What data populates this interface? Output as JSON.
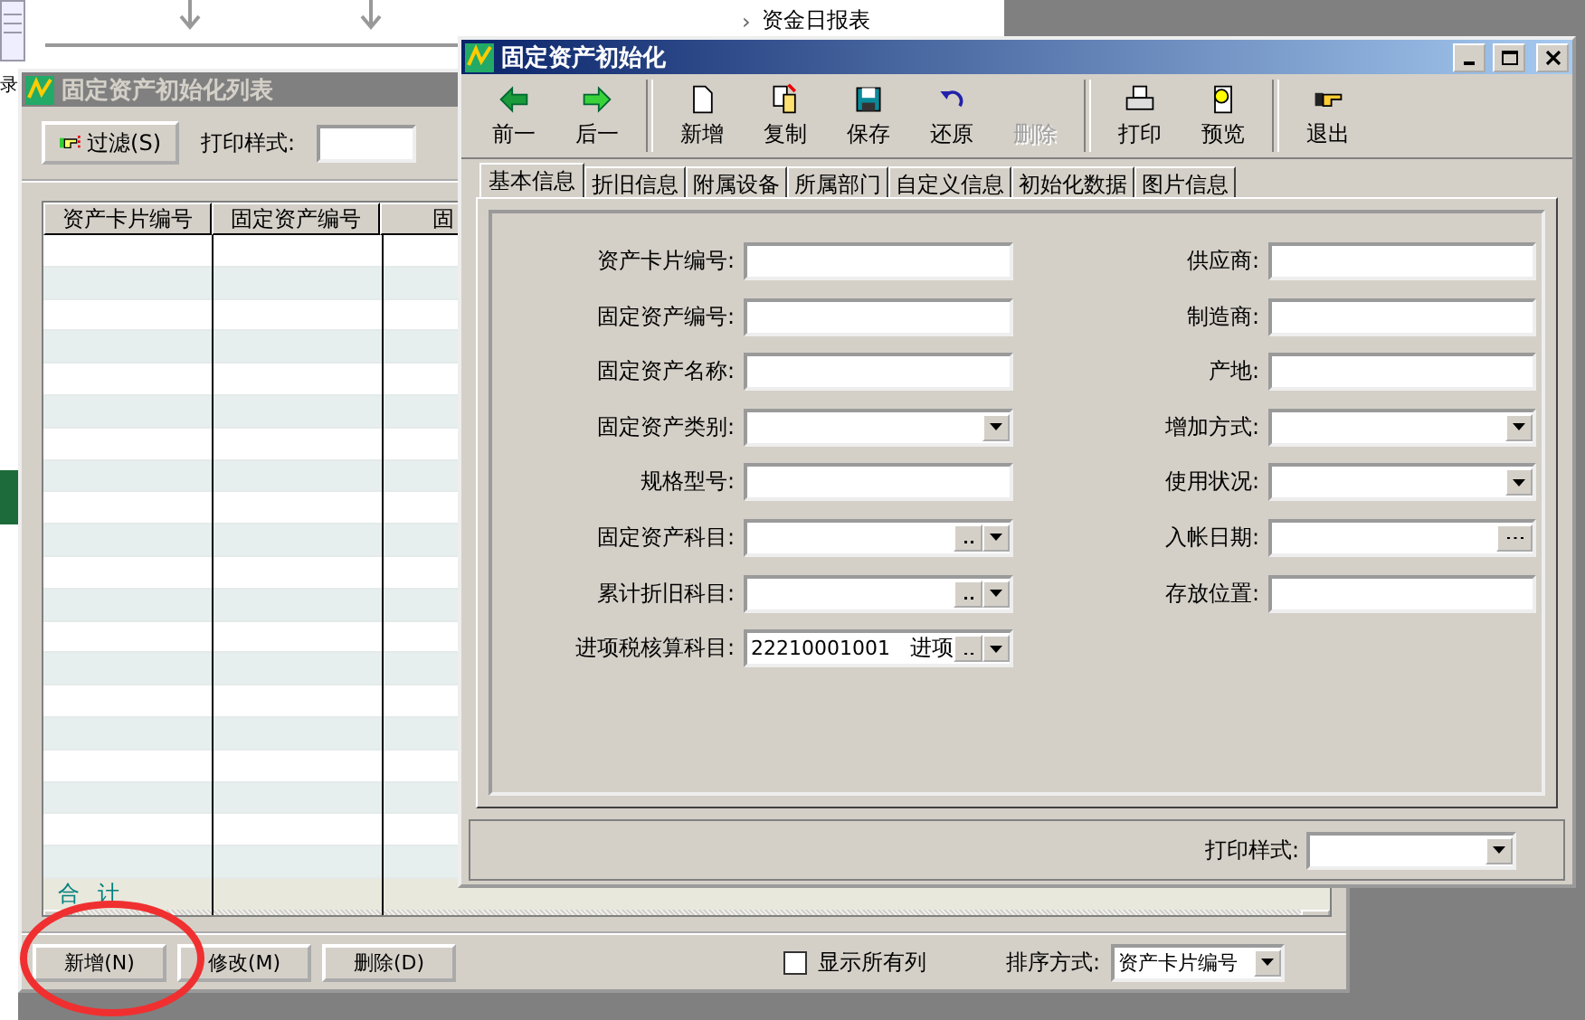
{
  "background": {
    "flow_caret": "›",
    "flow_label": "资金日报表",
    "left_label": "录"
  },
  "list_window": {
    "title": "固定资产初始化列表",
    "filter_button": "过滤(S)",
    "print_style_label": "打印样式:",
    "columns": [
      "资产卡片编号",
      "固定资产编号",
      "固"
    ],
    "total_label": "合 计",
    "buttons": [
      {
        "label": "新增(N)"
      },
      {
        "label": "修改(M)"
      },
      {
        "label": "删除(D)"
      }
    ],
    "show_all_columns": {
      "label": "显示所有列",
      "checked": false
    },
    "sort": {
      "label": "排序方式:",
      "value": "资产卡片编号"
    }
  },
  "dialog": {
    "title": "固定资产初始化",
    "toolbar": [
      [
        {
          "label": "前一",
          "kind": "prev",
          "disabled": false
        },
        {
          "label": "后一",
          "kind": "next",
          "disabled": false
        }
      ],
      [
        {
          "label": "新增",
          "kind": "new",
          "disabled": false
        },
        {
          "label": "复制",
          "kind": "copy",
          "disabled": false
        },
        {
          "label": "保存",
          "kind": "save",
          "disabled": false
        },
        {
          "label": "还原",
          "kind": "undo",
          "disabled": false
        },
        {
          "label": "删除",
          "kind": "delete",
          "disabled": true
        }
      ],
      [
        {
          "label": "打印",
          "kind": "print",
          "disabled": false
        },
        {
          "label": "预览",
          "kind": "preview",
          "disabled": false
        }
      ],
      [
        {
          "label": "退出",
          "kind": "exit",
          "disabled": false
        }
      ]
    ],
    "tabs": [
      {
        "label": "基本信息",
        "selected": true
      },
      {
        "label": "折旧信息",
        "selected": false
      },
      {
        "label": "附属设备",
        "selected": false
      },
      {
        "label": "所属部门",
        "selected": false
      },
      {
        "label": "自定义信息",
        "selected": false
      },
      {
        "label": "初始化数据",
        "selected": false
      },
      {
        "label": "图片信息",
        "selected": false
      }
    ],
    "fields_left": [
      {
        "label": "资产卡片编号:",
        "kind": "text"
      },
      {
        "label": "固定资产编号:",
        "kind": "text"
      },
      {
        "label": "固定资产名称:",
        "kind": "text"
      },
      {
        "label": "固定资产类别:",
        "kind": "select"
      },
      {
        "label": "规格型号:",
        "kind": "text"
      },
      {
        "label": "固定资产科目:",
        "kind": "lookup"
      },
      {
        "label": "累计折旧科目:",
        "kind": "lookup"
      },
      {
        "label": "进项税核算科目:",
        "kind": "lookup",
        "value": "22210001001",
        "value_2": "进项"
      }
    ],
    "fields_right": [
      {
        "label": "供应商:",
        "kind": "text"
      },
      {
        "label": "制造商:",
        "kind": "text"
      },
      {
        "label": "产地:",
        "kind": "text"
      },
      {
        "label": "增加方式:",
        "kind": "select"
      },
      {
        "label": "使用状况:",
        "kind": "select"
      },
      {
        "label": "入帐日期:",
        "kind": "date"
      },
      {
        "label": "存放位置:",
        "kind": "text"
      }
    ],
    "print_style_label": "打印样式:"
  }
}
